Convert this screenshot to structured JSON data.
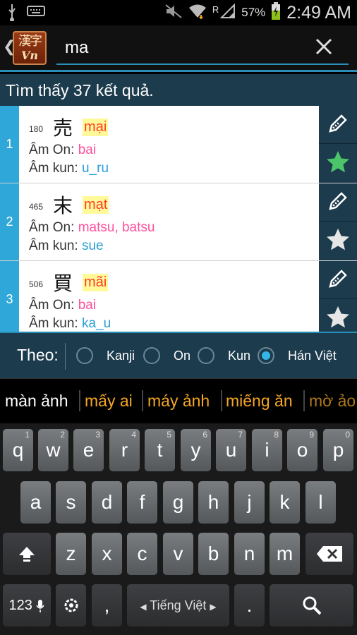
{
  "status_bar": {
    "battery_percent": "57%",
    "time": "2:49 AM",
    "signal_label": "R",
    "icons": [
      "usb-icon",
      "keyboard-icon",
      "mute-icon",
      "wifi-icon",
      "signal-icon",
      "battery-icon"
    ]
  },
  "header": {
    "logo_top": "漢字",
    "logo_bottom": "Vn",
    "search_value": "ma",
    "back_glyph": "❮"
  },
  "results_count": "Tìm thấy 37 kết quả.",
  "results": [
    {
      "index": "1",
      "strokes": "180",
      "kanji": "売",
      "hanviet": "mại",
      "on_label": "Âm On:",
      "on": "bai",
      "kun_label": "Âm kun:",
      "kun": "u_ru",
      "favorite": true
    },
    {
      "index": "2",
      "strokes": "465",
      "kanji": "末",
      "hanviet": "mạt",
      "on_label": "Âm On:",
      "on": "matsu, batsu",
      "kun_label": "Âm kun:",
      "kun": "sue",
      "favorite": false
    },
    {
      "index": "3",
      "strokes": "506",
      "kanji": "買",
      "hanviet": "mãi",
      "on_label": "Âm On:",
      "on": "bai",
      "kun_label": "Âm kun:",
      "kun": "ka_u",
      "favorite": false
    }
  ],
  "filter": {
    "label": "Theo:",
    "options": [
      {
        "label": "Kanji",
        "checked": false
      },
      {
        "label": "On",
        "checked": false
      },
      {
        "label": "Kun",
        "checked": false
      },
      {
        "label": "Hán Việt",
        "checked": true
      }
    ]
  },
  "suggestions": [
    "màn ảnh",
    "mấy ai",
    "máy ảnh",
    "miếng ăn",
    "mờ ảo"
  ],
  "keyboard": {
    "row1": [
      {
        "key": "q",
        "hint": "1"
      },
      {
        "key": "w",
        "hint": "2"
      },
      {
        "key": "e",
        "hint": "3"
      },
      {
        "key": "r",
        "hint": "4"
      },
      {
        "key": "t",
        "hint": "5"
      },
      {
        "key": "y",
        "hint": "6"
      },
      {
        "key": "u",
        "hint": "7"
      },
      {
        "key": "i",
        "hint": "8"
      },
      {
        "key": "o",
        "hint": "9"
      },
      {
        "key": "p",
        "hint": "0"
      }
    ],
    "row2": [
      "a",
      "s",
      "d",
      "f",
      "g",
      "h",
      "j",
      "k",
      "l"
    ],
    "row3": [
      "z",
      "x",
      "c",
      "v",
      "b",
      "n",
      "m"
    ],
    "symbols_label": "123",
    "comma": ",",
    "period": ".",
    "space_label": "Tiếng Việt",
    "colors": {
      "accent": "#33b5e5",
      "suggest_primary": "#ffffff",
      "suggest_other": "#f5a623"
    }
  }
}
